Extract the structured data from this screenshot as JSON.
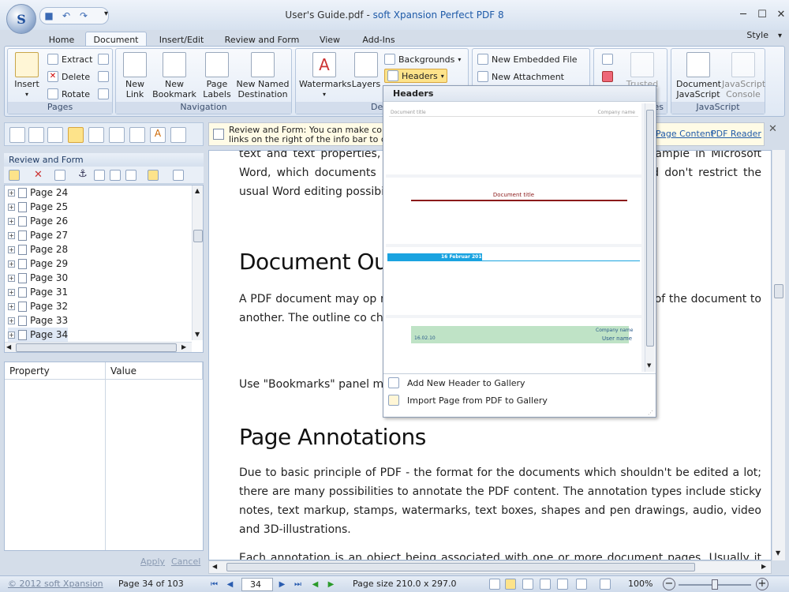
{
  "window": {
    "title": "User's Guide.pdf",
    "app_name": "soft Xpansion Perfect PDF 8",
    "separator": " - "
  },
  "menu_tabs": [
    "Home",
    "Document",
    "Insert/Edit",
    "Review and Form",
    "View",
    "Add-Ins"
  ],
  "style_label": "Style",
  "ribbon": {
    "pages": {
      "label": "Pages",
      "insert": "Insert",
      "extract": "Extract",
      "delete": "Delete",
      "rotate": "Rotate"
    },
    "navigation": {
      "label": "Navigation",
      "new_link": "New\nLink",
      "new_bookmark": "New\nBookmark",
      "page_labels": "Page\nLabels",
      "new_named_destination": "New Named\nDestination"
    },
    "decoration": {
      "label": "Deco",
      "watermarks": "Watermarks",
      "layers": "Layers",
      "backgrounds": "Backgrounds",
      "headers": "Headers"
    },
    "attachments": {
      "new_embedded_file": "New Embedded File",
      "new_attachment": "New Attachment"
    },
    "security": {
      "label": "es",
      "trusted": "Trusted\ns"
    },
    "javascript": {
      "label": "JavaScript",
      "document_js": "Document\nJavaScript",
      "js_console": "JavaScript\nConsole"
    }
  },
  "infobar": {
    "line1": "Review and Form: You can make comm",
    "line2": "links on the right of the info bar to ch",
    "link_page_content": "Page Content",
    "link_pdf_reader": "PDF Reader"
  },
  "panel": {
    "title": "Review and Form",
    "pages": [
      "Page 24",
      "Page 25",
      "Page 26",
      "Page 27",
      "Page 28",
      "Page 29",
      "Page 30",
      "Page 31",
      "Page 32",
      "Page 33",
      "Page 34"
    ],
    "selected_page": "Page 34",
    "prop_header": "Property",
    "value_header": "Value",
    "apply": "Apply",
    "cancel": "Cancel"
  },
  "document": {
    "para1": "text and text properties, i                                                             more information). However it doesn't allow                                                             ample in Microsoft Word, which documents                                                              ble to convert PDF document to Word docum                                                             d don't restrict the usual Word editing possibi",
    "heading1": "Document Out",
    "para2": "A PDF document may op                                                          munity traditionally called \"bookmarks\"), allov                                                          rt of the document to another. The outline co                                                          ch serve as a visual table of contents to display",
    "para3": "Use \"Bookmarks\" panel                                                          marks in your PDF document.",
    "heading2": "Page Annotations",
    "para4": "Due to basic principle of PDF - the format for the documents which shouldn't be edited a lot; there are many possibilities to annotate the PDF content. The annotation types include sticky notes, text markup, stamps, watermarks, text boxes, shapes and pen drawings, audio, video and 3D-illustrations.",
    "para5": "Each annotation is an object being associated with one or more document pages. Usually it has"
  },
  "headers_dropdown": {
    "title": "Headers",
    "gallery": [
      {
        "left": "Document title",
        "right": "Company name"
      },
      {
        "center": "Document title"
      },
      {
        "date": "16 Februar 2010"
      },
      {
        "date": "16.02.10",
        "company": "Company name",
        "user": "User name"
      }
    ],
    "add_new": "Add New Header to Gallery",
    "import_page": "Import Page from PDF to Gallery"
  },
  "status": {
    "copyright": "© 2012 soft Xpansion",
    "page_of": "Page 34 of 103",
    "page_input": "34",
    "page_size": "Page size 210.0 x 297.0",
    "zoom": "100%"
  },
  "colors": {
    "accent": "#1e5aa8",
    "header_red": "#8b1a1a",
    "header_blue": "#1aa3e0",
    "header_green": "#bfe3c6"
  }
}
